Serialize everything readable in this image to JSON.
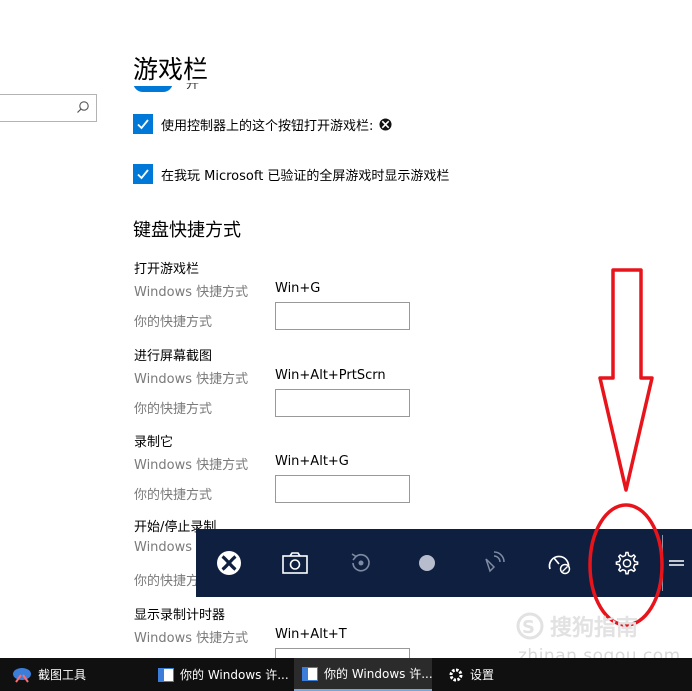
{
  "page": {
    "title": "游戏栏",
    "search_placeholder": ""
  },
  "checkboxes": [
    {
      "label": "使用控制器上的这个按钮打开游戏栏:",
      "checked": true,
      "icon": "xbox-logo-icon"
    },
    {
      "label": "在我玩 Microsoft 已验证的全屏游戏时显示游戏栏",
      "checked": true
    }
  ],
  "keyboard_section": {
    "heading": "键盘快捷方式",
    "windows_label": "Windows 快捷方式",
    "custom_label": "你的快捷方式",
    "groups": [
      {
        "title": "打开游戏栏",
        "windows_shortcut": "Win+G",
        "custom_value": ""
      },
      {
        "title": "进行屏幕截图",
        "windows_shortcut": "Win+Alt+PrtScrn",
        "custom_value": ""
      },
      {
        "title": "录制它",
        "windows_shortcut": "Win+Alt+G",
        "custom_value": ""
      },
      {
        "title": "开始/停止录制",
        "windows_shortcut": "",
        "custom_value": ""
      },
      {
        "title": "显示录制计时器",
        "windows_shortcut": "Win+Alt+T",
        "custom_value": ""
      }
    ],
    "partial_windows_label": "Windows",
    "partial_custom_label": "你的快捷方"
  },
  "game_bar": {
    "buttons": [
      "xbox-icon",
      "camera-icon",
      "record-last-icon",
      "record-dot-icon",
      "broadcast-icon",
      "gauge-icon",
      "settings-gear-icon"
    ],
    "background": "#0f1f3f"
  },
  "annotation": {
    "color": "#e8141c",
    "shapes": [
      "down-arrow",
      "ellipse-highlight"
    ]
  },
  "watermark": {
    "text": "搜狗指南",
    "url": "zhinan.sogou.com"
  },
  "taskbar": {
    "items": [
      {
        "label": "截图工具",
        "icon": "snipping-tool-icon"
      },
      {
        "label": "你的 Windows 许...",
        "icon": "window-icon"
      },
      {
        "label": "你的 Windows 许...",
        "icon": "window-icon"
      },
      {
        "label": "设置",
        "icon": "gear-icon"
      }
    ]
  },
  "colors": {
    "accent": "#0078d7",
    "secondary_text": "#7a7a7a",
    "taskbar": "#101010"
  }
}
